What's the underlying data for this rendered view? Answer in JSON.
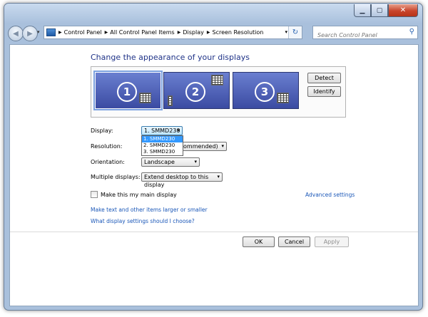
{
  "window": {
    "minimize_glyph": "▁",
    "maximize_glyph": "▢",
    "close_glyph": "✕"
  },
  "nav": {
    "back_glyph": "◀",
    "forward_glyph": "▶",
    "history_glyph": "▾",
    "breadcrumbs": [
      "Control Panel",
      "All Control Panel Items",
      "Display",
      "Screen Resolution"
    ],
    "separator_glyph": "▶",
    "address_dropdown_glyph": "▾",
    "refresh_glyph": "↻",
    "search_placeholder": "Search Control Panel",
    "search_icon_glyph": "⚲"
  },
  "page": {
    "heading": "Change the appearance of your displays",
    "monitors": [
      {
        "number": "1",
        "selected": true
      },
      {
        "number": "2",
        "selected": false
      },
      {
        "number": "3",
        "selected": false
      }
    ],
    "detect_label": "Detect",
    "identify_label": "Identify"
  },
  "form": {
    "display_label": "Display:",
    "display_value": "1. SMMD230",
    "display_options": [
      "1. SMMD230",
      "2. SMMD230",
      "3. SMMD230"
    ],
    "resolution_label": "Resolution:",
    "resolution_value": "ommended)",
    "orientation_label": "Orientation:",
    "orientation_value": "Landscape",
    "multiple_label": "Multiple displays:",
    "multiple_value": "Extend desktop to this display",
    "dropdown_arrow": "▾",
    "main_display_label": "Make this my main display",
    "main_display_checked": false,
    "advanced_link": "Advanced settings",
    "text_size_link": "Make text and other items larger or smaller",
    "which_settings_link": "What display settings should I choose?"
  },
  "footer": {
    "ok_label": "OK",
    "cancel_label": "Cancel",
    "apply_label": "Apply"
  }
}
